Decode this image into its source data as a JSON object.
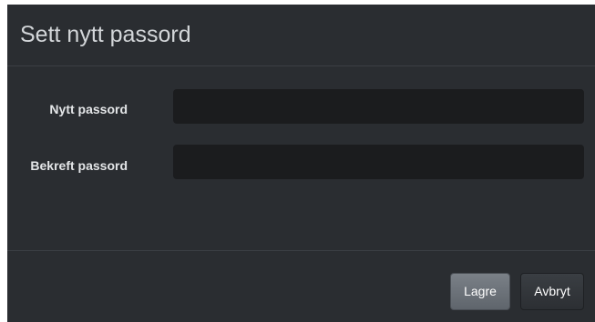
{
  "dialog": {
    "title": "Sett nytt passord",
    "fields": {
      "new_password": {
        "label": "Nytt passord",
        "value": ""
      },
      "confirm_password": {
        "label": "Bekreft passord",
        "value": ""
      }
    },
    "buttons": {
      "save_label": "Lagre",
      "cancel_label": "Avbryt"
    }
  }
}
